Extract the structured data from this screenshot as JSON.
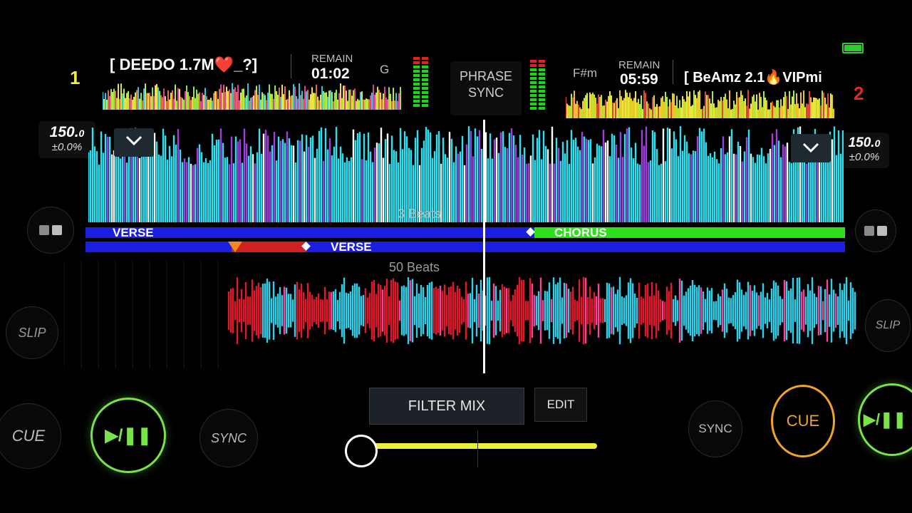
{
  "deck1": {
    "number": "1",
    "title": "[ DEEDO 1.7M❤️_?]",
    "remain_label": "REMAIN",
    "remain_time": "01:02",
    "key": "G",
    "bpm": "150.",
    "bpm_decimal": "0",
    "pitch": "±0.0%",
    "slip_label": "SLIP",
    "cue_label": "CUE",
    "play_label": "▶/❚❚",
    "sync_label": "SYNC",
    "beats_label": "50 Beats",
    "phrase": [
      "VERSE"
    ],
    "number_color": "#f2e94a",
    "waveform_colors": [
      "#30d0e8",
      "#e01a2a",
      "#ff3f9a"
    ]
  },
  "deck2": {
    "number": "2",
    "title": "[ BeAmz 2.1🔥VIPmi",
    "remain_label": "REMAIN",
    "remain_time": "05:59",
    "key": "F#m",
    "bpm": "150.",
    "bpm_decimal": "0",
    "pitch": "±0.0%",
    "slip_label": "SLIP",
    "cue_label": "CUE",
    "play_label": "▶/❚❚",
    "sync_label": "SYNC",
    "beats_label": "3 Beats",
    "phrase": [
      "VERSE",
      "CHORUS"
    ],
    "number_color": "#e02a2a",
    "waveform_colors": [
      "#2fe0f0",
      "#a040e0",
      "#ffffff"
    ]
  },
  "center": {
    "phrase_sync_line1": "PHRASE",
    "phrase_sync_line2": "SYNC",
    "filter_mix_label": "FILTER MIX",
    "edit_label": "EDIT",
    "crossfader_color": "#e6f03a"
  },
  "colors": {
    "verse": "#1a1ee0",
    "chorus": "#2ee01a",
    "loop_red": "#d02020",
    "play_green": "#7be34a",
    "cue_orange": "#f0a526",
    "battery": "#2ecc2e"
  },
  "icons": {
    "collapse": "chevron-down-icon",
    "view_toggle": "split-view-icon",
    "battery": "battery-icon"
  }
}
